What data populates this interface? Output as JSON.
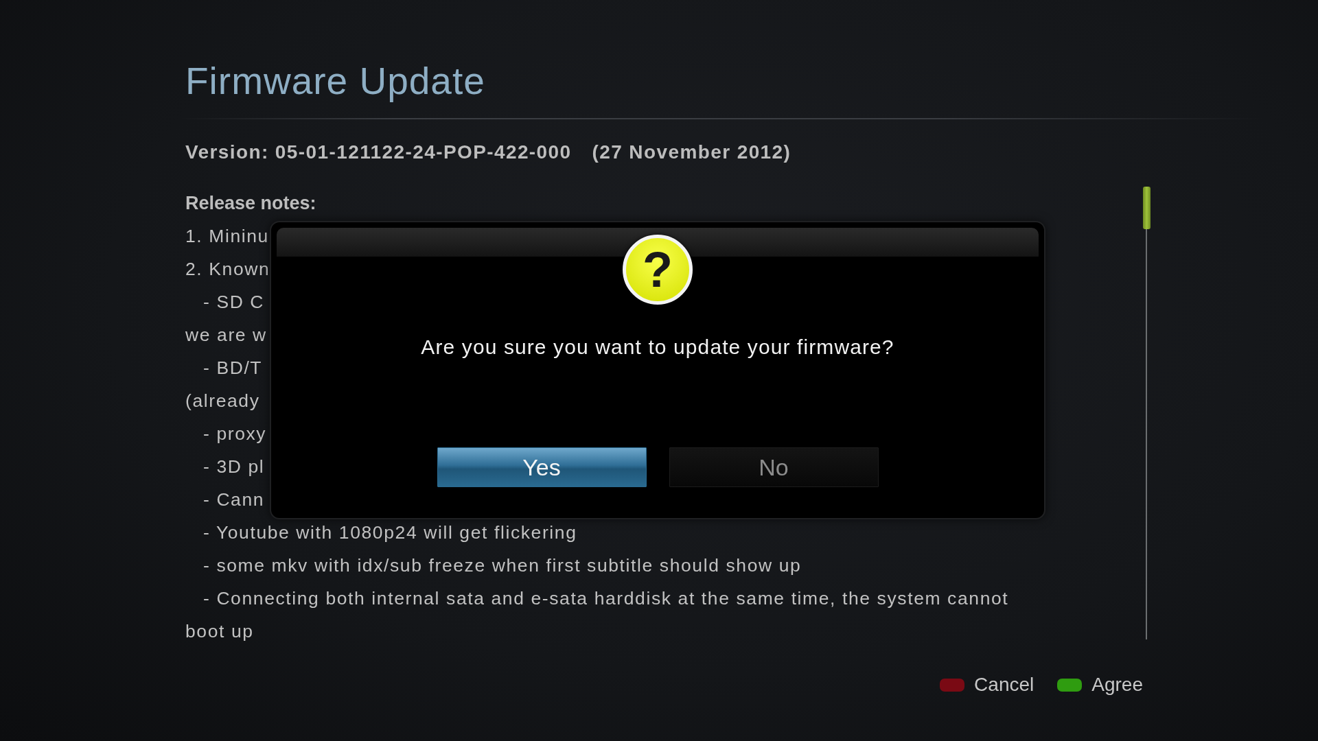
{
  "screen": {
    "title": "Firmware Update"
  },
  "version": {
    "number": "Version: 05-01-121122-24-POP-422-000",
    "date": "(27 November 2012)"
  },
  "release_notes": {
    "heading": "Release notes:",
    "lines": [
      {
        "kind": "item",
        "text": "1. Mininu"
      },
      {
        "kind": "item",
        "text": "2. Known"
      },
      {
        "kind": "sub",
        "text": "- SD C"
      },
      {
        "kind": "item",
        "text": "we are w"
      },
      {
        "kind": "sub",
        "text": "- BD/T"
      },
      {
        "kind": "item",
        "text": "(already"
      },
      {
        "kind": "sub",
        "text": "- proxy"
      },
      {
        "kind": "sub",
        "text": "- 3D pl"
      },
      {
        "kind": "sub",
        "text": "- Cann"
      },
      {
        "kind": "sub",
        "text": "- Youtube with 1080p24 will get flickering"
      },
      {
        "kind": "sub",
        "text": "- some mkv with idx/sub freeze when first subtitle should show up"
      },
      {
        "kind": "sub",
        "text": "- Connecting both internal sata and e-sata harddisk at the same time, the system cannot"
      },
      {
        "kind": "item",
        "text": "boot up"
      }
    ]
  },
  "legend": [
    {
      "label": "Cancel",
      "color": "#7a0a14"
    },
    {
      "label": "Agree",
      "color": "#2f9c10"
    }
  ],
  "dialog": {
    "icon_glyph": "?",
    "question": "Are you sure you want to update your firmware?",
    "buttons": [
      {
        "label": "Yes",
        "selected": true
      },
      {
        "label": "No",
        "selected": false
      }
    ]
  }
}
